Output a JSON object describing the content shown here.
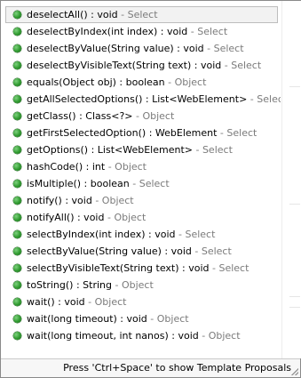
{
  "proposals": [
    {
      "signature": "deselectAll() : void",
      "owner": "Select",
      "selected": true
    },
    {
      "signature": "deselectByIndex(int index) : void",
      "owner": "Select"
    },
    {
      "signature": "deselectByValue(String value) : void",
      "owner": "Select"
    },
    {
      "signature": "deselectByVisibleText(String text) : void",
      "owner": "Select"
    },
    {
      "signature": "equals(Object obj) : boolean",
      "owner": "Object"
    },
    {
      "signature": "getAllSelectedOptions() : List<WebElement>",
      "owner": "Select"
    },
    {
      "signature": "getClass() : Class<?>",
      "owner": "Object"
    },
    {
      "signature": "getFirstSelectedOption() : WebElement",
      "owner": "Select"
    },
    {
      "signature": "getOptions() : List<WebElement>",
      "owner": "Select"
    },
    {
      "signature": "hashCode() : int",
      "owner": "Object"
    },
    {
      "signature": "isMultiple() : boolean",
      "owner": "Select"
    },
    {
      "signature": "notify() : void",
      "owner": "Object"
    },
    {
      "signature": "notifyAll() : void",
      "owner": "Object"
    },
    {
      "signature": "selectByIndex(int index) : void",
      "owner": "Select"
    },
    {
      "signature": "selectByValue(String value) : void",
      "owner": "Select"
    },
    {
      "signature": "selectByVisibleText(String text) : void",
      "owner": "Select"
    },
    {
      "signature": "toString() : String",
      "owner": "Object"
    },
    {
      "signature": "wait() : void",
      "owner": "Object"
    },
    {
      "signature": "wait(long timeout) : void",
      "owner": "Object"
    },
    {
      "signature": "wait(long timeout, int nanos) : void",
      "owner": "Object"
    }
  ],
  "separator": " - ",
  "status": {
    "hint": "Press 'Ctrl+Space' to show Template Proposals"
  },
  "icons": {
    "method": "public-method-icon",
    "resize": "resize-grip-icon"
  },
  "colors": {
    "owner_text": "#7a7a7a",
    "bullet": "#2f9a2f",
    "selection_bg": "#f2f2f2"
  }
}
